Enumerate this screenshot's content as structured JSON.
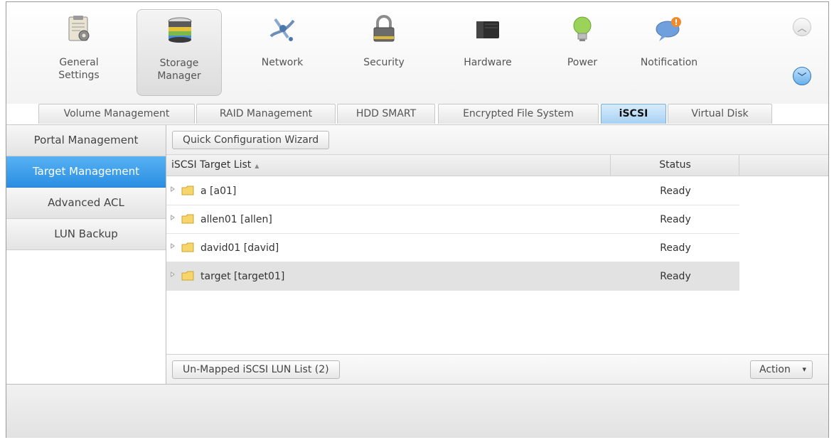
{
  "toolbar": {
    "items": [
      {
        "label": "General\nSettings",
        "icon": "general-settings-icon",
        "active": false
      },
      {
        "label": "Storage\nManager",
        "icon": "storage-manager-icon",
        "active": true
      },
      {
        "label": "Network",
        "icon": "network-icon",
        "active": false
      },
      {
        "label": "Security",
        "icon": "security-lock-icon",
        "active": false
      },
      {
        "label": "Hardware",
        "icon": "hardware-icon",
        "active": false
      },
      {
        "label": "Power",
        "icon": "power-bulb-icon",
        "active": false
      },
      {
        "label": "Notification",
        "icon": "notification-icon",
        "active": false
      }
    ],
    "scroll_up_icon": "chevron-up-icon",
    "scroll_down_icon": "chevron-down-icon"
  },
  "tabs": [
    {
      "label": "Volume Management",
      "active": false
    },
    {
      "label": "RAID Management",
      "active": false
    },
    {
      "label": "HDD SMART",
      "active": false
    },
    {
      "label": "Encrypted File System",
      "active": false
    },
    {
      "label": "iSCSI",
      "active": true
    },
    {
      "label": "Virtual Disk",
      "active": false
    }
  ],
  "sidebar": {
    "items": [
      {
        "label": "Portal Management",
        "active": false
      },
      {
        "label": "Target Management",
        "active": true
      },
      {
        "label": "Advanced ACL",
        "active": false
      },
      {
        "label": "LUN Backup",
        "active": false
      }
    ]
  },
  "content": {
    "wizard_button": "Quick Configuration Wizard",
    "grid": {
      "columns": {
        "name": "iSCSI Target List",
        "sort_indicator": "▲",
        "status": "Status"
      },
      "rows": [
        {
          "name": "a [a01]",
          "status": "Ready",
          "selected": false
        },
        {
          "name": "allen01 [allen]",
          "status": "Ready",
          "selected": false
        },
        {
          "name": "david01 [david]",
          "status": "Ready",
          "selected": false
        },
        {
          "name": "target [target01]",
          "status": "Ready",
          "selected": true
        }
      ]
    },
    "unmapped_button": "Un-Mapped iSCSI LUN List (2)",
    "action_button": "Action",
    "action_arrow": "▾"
  },
  "colors": {
    "active_tab": "#a7d1f4",
    "active_sidebar": "#2a8ee2",
    "selected_row": "#e2e2e2"
  }
}
